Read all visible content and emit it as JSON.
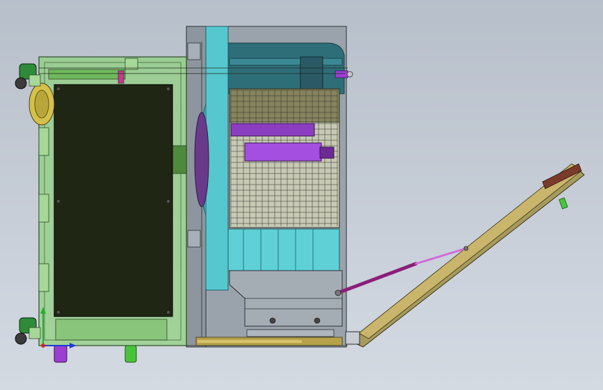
{
  "scene": {
    "kind": "cad-side-view",
    "background": "#c2c9d3"
  },
  "colors": {
    "enclosure_green": "#8fd07e",
    "enclosure_edge": "#2d4a25",
    "panel_dark": "#1f2614",
    "cyan_housing": "#56c7cf",
    "teal_dark": "#2b6f7a",
    "purple_part": "#9b3fd1",
    "gray_body": "#9aa3ab",
    "yellow_rail": "#b79a3c",
    "axis_x": "#1f3bd6",
    "axis_y": "#23b02c",
    "axis_z": "#d12a2a"
  },
  "icons": {
    "triad": "xyz-triad-icon"
  }
}
